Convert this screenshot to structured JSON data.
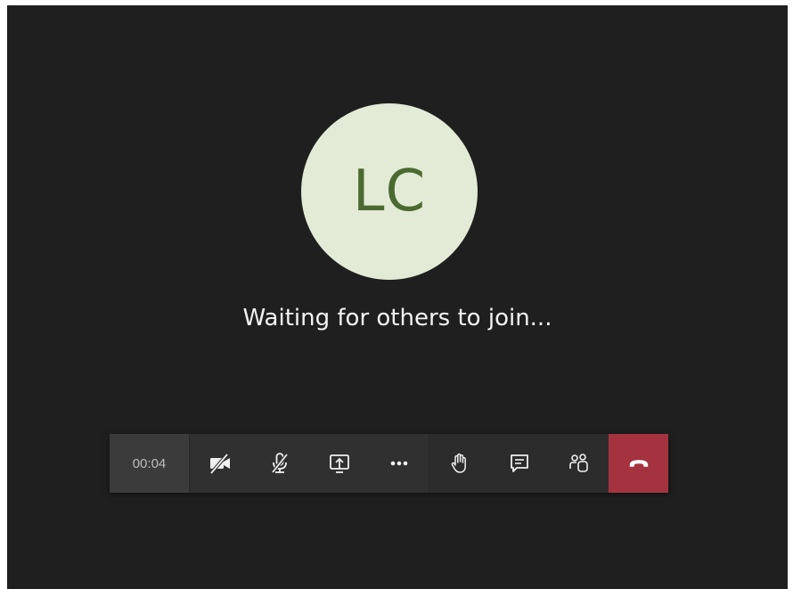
{
  "call": {
    "avatar_initials": "LC",
    "status_text": "Waiting for others to join...",
    "timer": "00:04"
  },
  "toolbar": {
    "buttons": [
      {
        "name": "camera-off-button",
        "icon": "camera-off-icon"
      },
      {
        "name": "mic-off-button",
        "icon": "mic-off-icon"
      },
      {
        "name": "share-screen-button",
        "icon": "share-screen-icon"
      },
      {
        "name": "more-actions-button",
        "icon": "more-icon"
      },
      {
        "name": "raise-hand-button",
        "icon": "raise-hand-icon"
      },
      {
        "name": "chat-button",
        "icon": "chat-icon"
      },
      {
        "name": "participants-button",
        "icon": "participants-icon"
      },
      {
        "name": "hang-up-button",
        "icon": "hang-up-icon"
      }
    ]
  },
  "colors": {
    "background": "#1f1f1f",
    "avatar_bg": "#e3ead6",
    "avatar_text": "#4b6a31",
    "toolbar_bg": "#303030",
    "hangup": "#a4333f"
  }
}
